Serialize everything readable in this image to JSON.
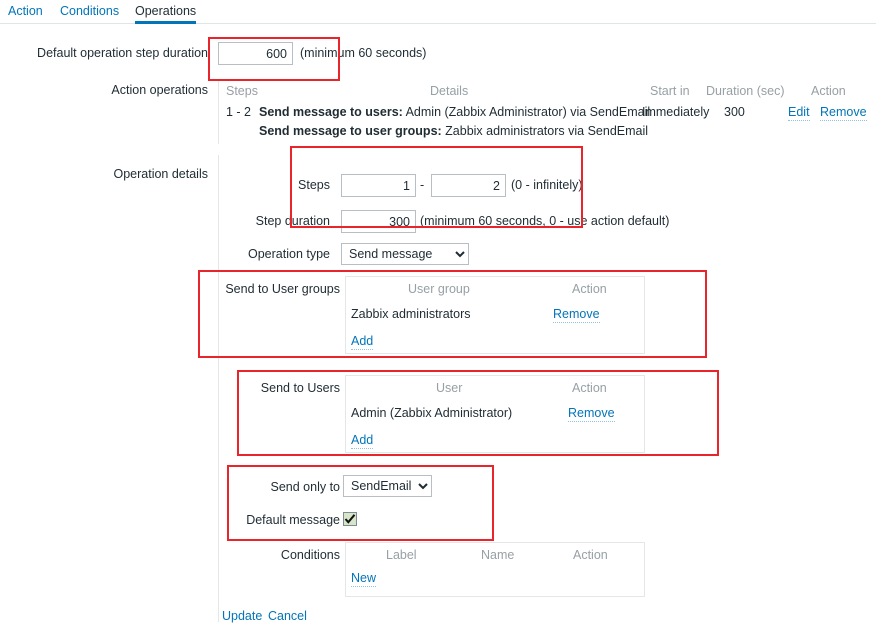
{
  "tabs": [
    {
      "label": "Action",
      "active": false
    },
    {
      "label": "Conditions",
      "active": false
    },
    {
      "label": "Operations",
      "active": true
    }
  ],
  "form": {
    "default_step_duration": {
      "label": "Default operation step duration",
      "value": "600",
      "hint": "(minimum 60 seconds)"
    },
    "action_operations": {
      "label": "Action operations",
      "columns": [
        "Steps",
        "Details",
        "Start in",
        "Duration (sec)",
        "Action"
      ],
      "rows": [
        {
          "steps": "1 - 2",
          "details_line1_bold": "Send message to users:",
          "details_line1_rest": " Admin (Zabbix Administrator) via SendEmail",
          "details_line2_bold": "Send message to user groups:",
          "details_line2_rest": " Zabbix administrators via SendEmail",
          "start_in": "Immediately",
          "duration": "300",
          "action_edit": "Edit",
          "action_remove": "Remove"
        }
      ]
    },
    "operation_details": {
      "label": "Operation details",
      "steps": {
        "label": "Steps",
        "from": "1",
        "separator": "-",
        "to": "2",
        "hint": "(0 - infinitely)"
      },
      "step_duration": {
        "label": "Step duration",
        "value": "300",
        "hint": "(minimum 60 seconds, 0 - use action default)"
      },
      "operation_type": {
        "label": "Operation type",
        "value": "Send message",
        "options": [
          "Send message"
        ]
      },
      "send_to_user_groups": {
        "label": "Send to User groups",
        "columns": [
          "User group",
          "Action"
        ],
        "rows": [
          {
            "name": "Zabbix administrators",
            "action": "Remove"
          }
        ],
        "add_label": "Add"
      },
      "send_to_users": {
        "label": "Send to Users",
        "columns": [
          "User",
          "Action"
        ],
        "rows": [
          {
            "name": "Admin (Zabbix Administrator)",
            "action": "Remove"
          }
        ],
        "add_label": "Add"
      },
      "send_only_to": {
        "label": "Send only to",
        "value": "SendEmail",
        "options": [
          "SendEmail"
        ]
      },
      "default_message": {
        "label": "Default message",
        "checked": true
      },
      "conditions": {
        "label": "Conditions",
        "columns": [
          "Label",
          "Name",
          "Action"
        ],
        "rows": [],
        "new_label": "New"
      },
      "footer": {
        "update_label": "Update",
        "cancel_label": "Cancel"
      }
    }
  },
  "colors": {
    "link": "#0275b8",
    "muted": "#97a0a5",
    "text": "#1f2c33",
    "border": "#e3e7ea",
    "input_border": "#b8bfc4",
    "annotation": "#e8252a",
    "checkbox_fill": "#d7e6c8"
  }
}
